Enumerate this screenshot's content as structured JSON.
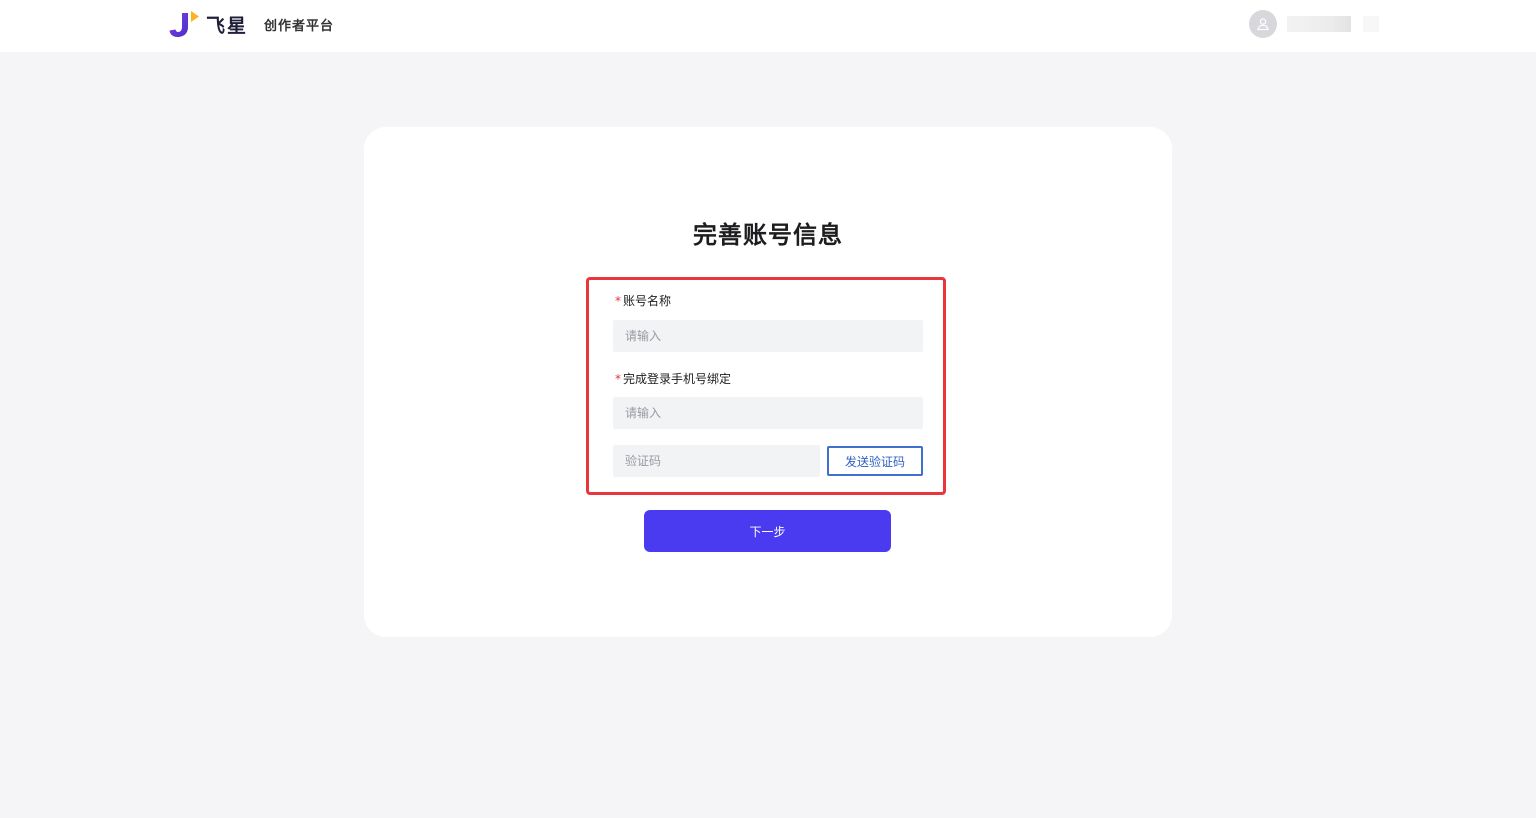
{
  "header": {
    "brand_name": "飞星",
    "brand_subtitle": "创作者平台",
    "logo_icon": "feixing-logo-icon",
    "avatar_icon": "user-icon"
  },
  "page": {
    "title": "完善账号信息"
  },
  "form": {
    "account_name": {
      "required_mark": "*",
      "label": "账号名称",
      "value": "",
      "placeholder": "请输入"
    },
    "phone_binding": {
      "required_mark": "*",
      "label": "完成登录手机号绑定",
      "value": "",
      "placeholder": "请输入"
    },
    "verification_code": {
      "value": "",
      "placeholder": "验证码"
    },
    "send_code_label": "发送验证码",
    "highlight_color": "#e8363b"
  },
  "actions": {
    "next_label": "下一步",
    "next_color": "#4a3bf1"
  }
}
